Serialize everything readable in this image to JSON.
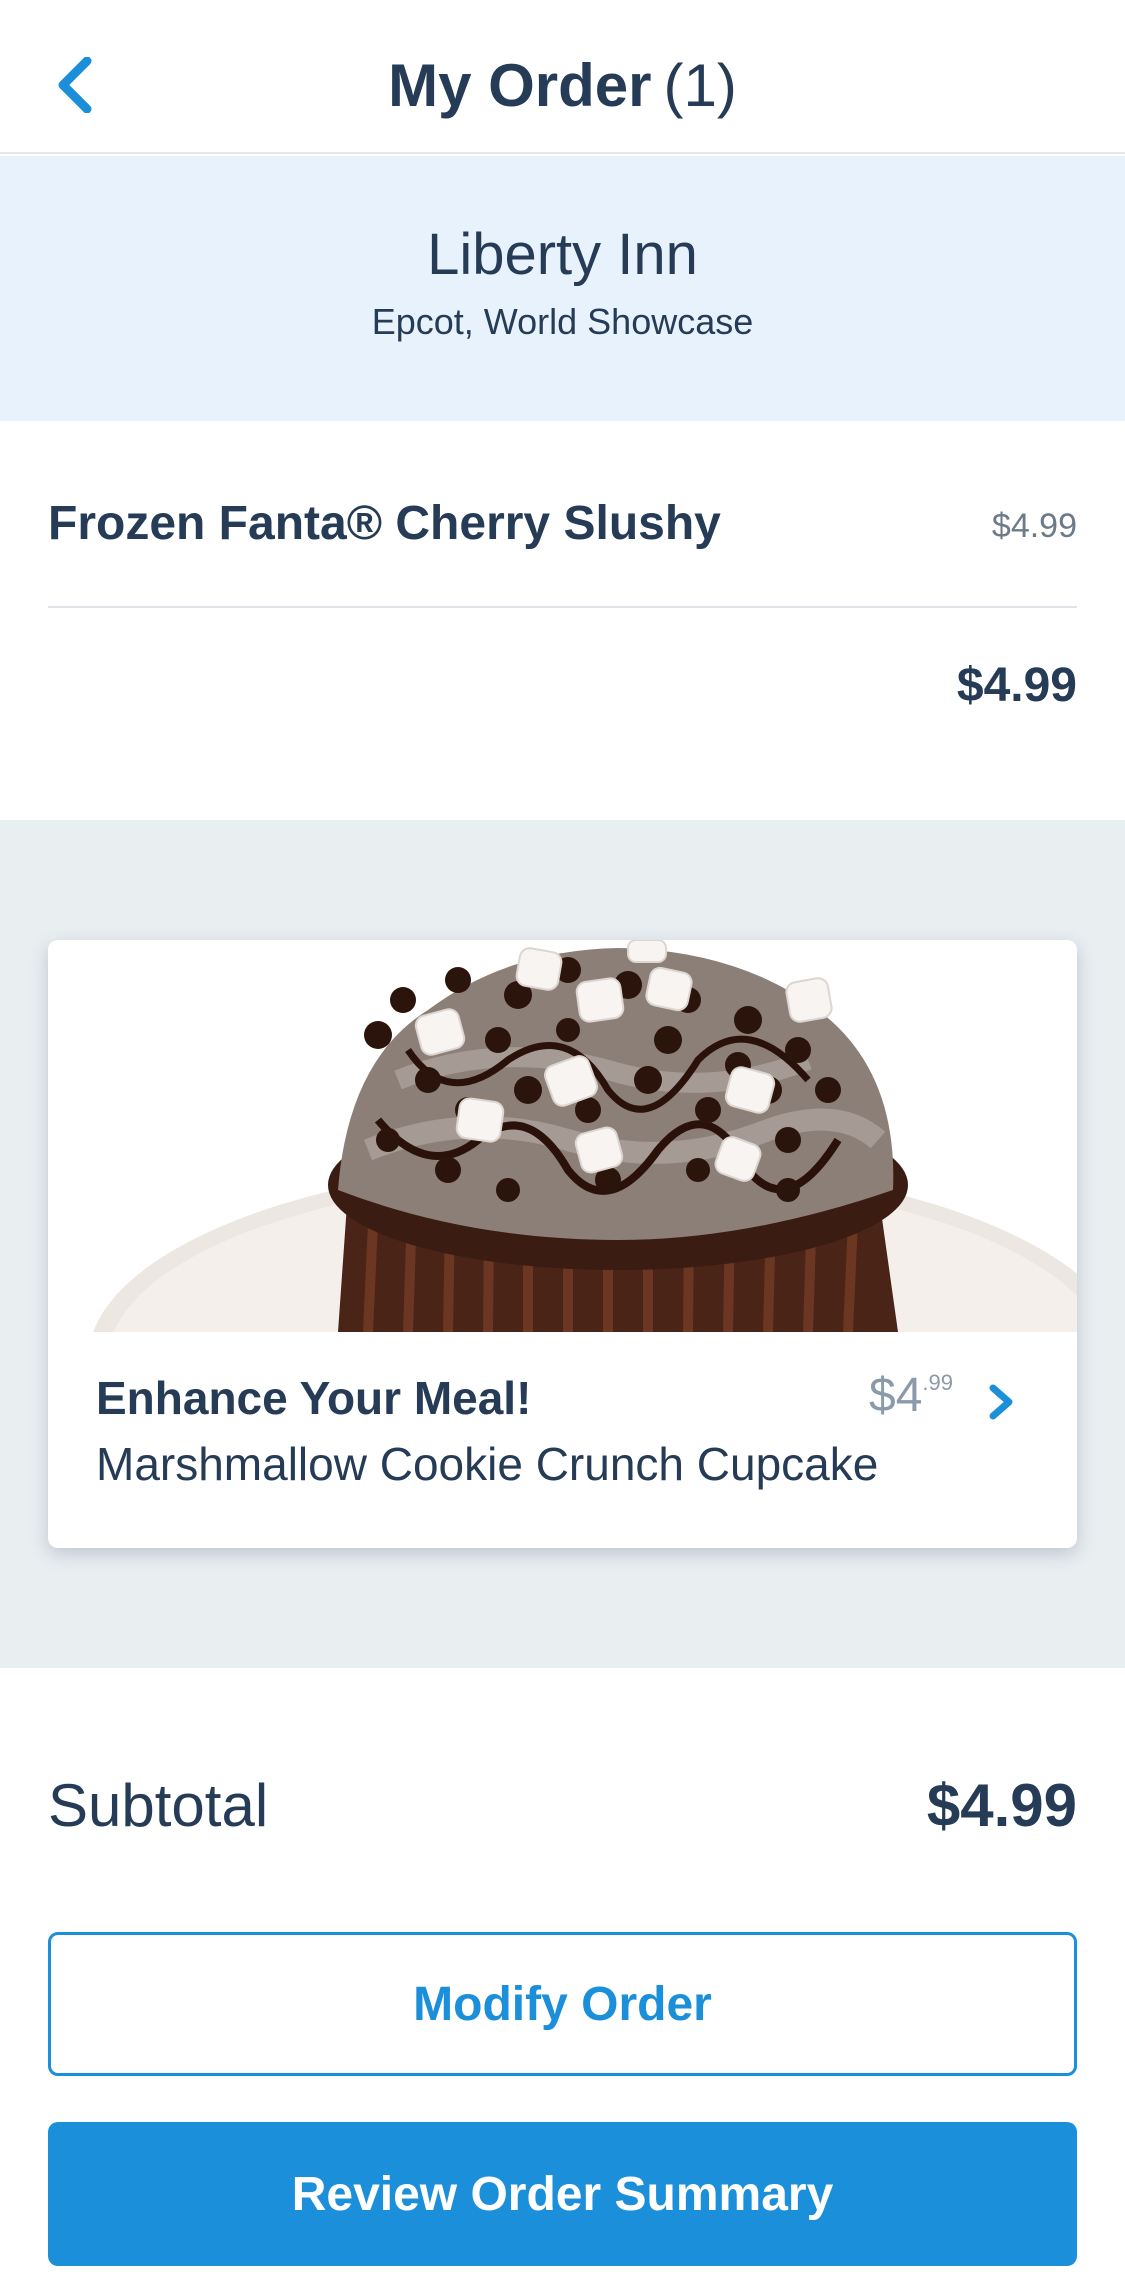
{
  "header": {
    "title": "My Order",
    "count": "(1)",
    "back_icon": "chevron-left-icon"
  },
  "restaurant": {
    "name": "Liberty Inn",
    "location": "Epcot, World Showcase"
  },
  "order": {
    "items": [
      {
        "name": "Frozen Fanta® Cherry Slushy",
        "price": "$4.99"
      }
    ],
    "total": "$4.99"
  },
  "upsell": {
    "title": "Enhance Your Meal!",
    "description": "Marshmallow Cookie Crunch Cupcake",
    "price_dollars": "$4",
    "price_cents": ".99",
    "image": "marshmallow-cookie-crunch-cupcake-photo",
    "chevron_icon": "chevron-right-icon"
  },
  "summary": {
    "subtotal_label": "Subtotal",
    "subtotal_value": "$4.99"
  },
  "actions": {
    "modify_label": "Modify Order",
    "review_label": "Review Order Summary"
  },
  "colors": {
    "accent": "#1b8fd9",
    "text": "#253b56",
    "restaurant_bg": "#e8f2fc",
    "upsell_bg": "#e9eef1"
  }
}
